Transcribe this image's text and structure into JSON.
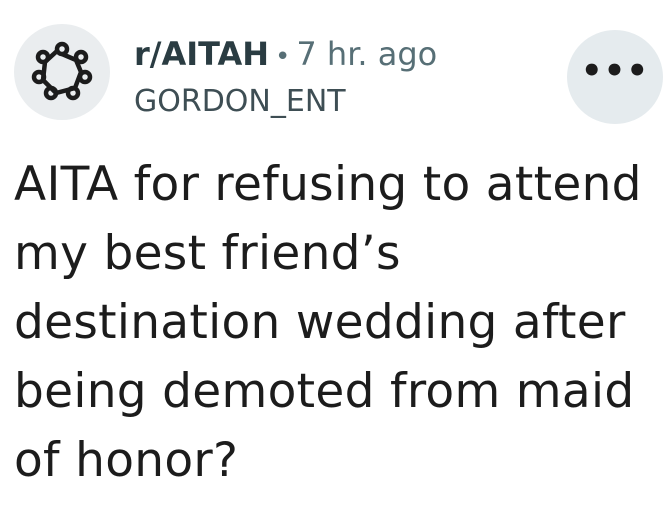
{
  "post": {
    "subreddit": "r/AITAH",
    "separator": "•",
    "time_ago": "7 hr. ago",
    "username": "GORDON_ENT",
    "more_label": "•••",
    "avatar_icon": "subreddit-ring-icon",
    "title": "AITA for refusing to attend my best friend’s destination wedding after being demoted from maid of honor?"
  }
}
